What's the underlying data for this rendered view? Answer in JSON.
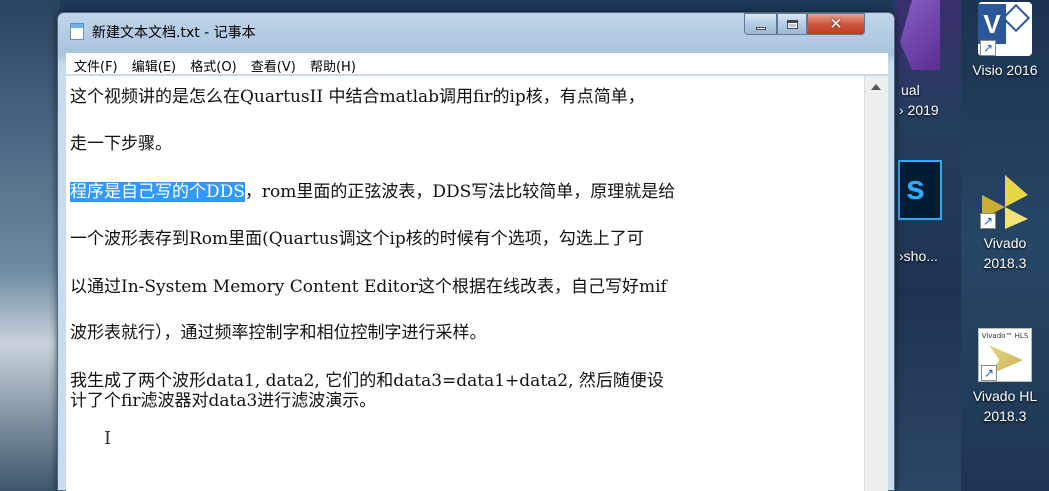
{
  "window": {
    "title": "新建文本文档.txt - 记事本"
  },
  "menu": [
    "文件(F)",
    "编辑(E)",
    "格式(O)",
    "查看(V)",
    "帮助(H)"
  ],
  "editor": {
    "lines": [
      "这个视频讲的是怎么在QuartusII 中结合matlab调用fir的ip核，有点简单，",
      "走一下步骤。",
      "程序是自己写的个DDS",
      "，rom里面的正弦波表，DDS写法比较简单，原理就是给",
      "一个波形表存到Rom里面(Quartus调这个ip核的时候有个选项，勾选上了可",
      "以通过In-System Memory Content Editor这个根据在线改表，自己写好mif",
      "波形表就行），通过频率控制字和相位控制字进行采样。",
      "我生成了两个波形data1, data2, 它们的和data3=data1+data2, 然后随便设",
      "计了个fir滤波器对data3进行滤波演示。"
    ]
  },
  "desktop": {
    "icons": [
      {
        "label1": "Visio 2016",
        "icon": "visio-icon"
      },
      {
        "label1": "Vivado",
        "label2": "2018.3",
        "icon": "vivado-icon"
      },
      {
        "label1": "Vivado HL",
        "label2": "2018.3",
        "icon": "vivado-hls-icon",
        "tile_text": "Vivado™ HLS"
      }
    ],
    "partial_labels": [
      "ual",
      "› 2019",
      "›sho..."
    ]
  },
  "colors": {
    "selection": "#3399ff",
    "close_button": "#c13b20"
  }
}
